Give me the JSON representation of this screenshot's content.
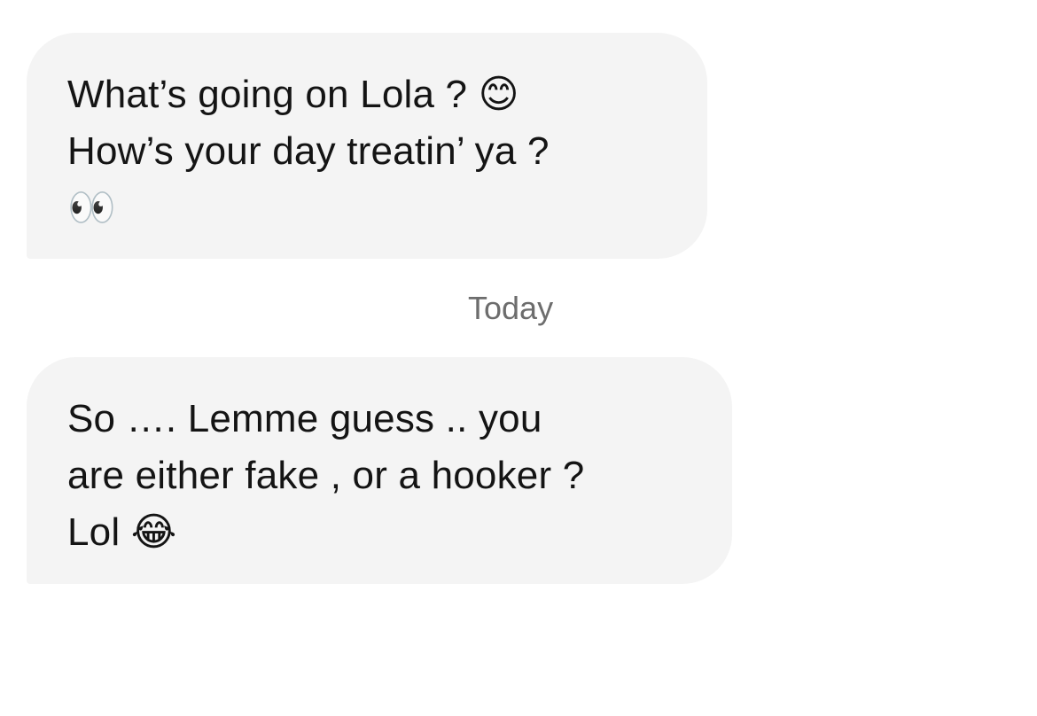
{
  "messages": [
    {
      "lines": [
        "What’s going on Lola ? 😊",
        "How’s your day treatin’ ya ?",
        "👀"
      ]
    },
    {
      "lines": [
        "So …. Lemme guess .. you",
        "are either fake , or a hooker ?",
        "Lol 😂"
      ]
    }
  ],
  "divider": {
    "label": "Today"
  },
  "colors": {
    "bubble_bg": "#f4f4f4",
    "text": "#141414",
    "divider_text": "#6d6d6d",
    "background": "#ffffff"
  }
}
